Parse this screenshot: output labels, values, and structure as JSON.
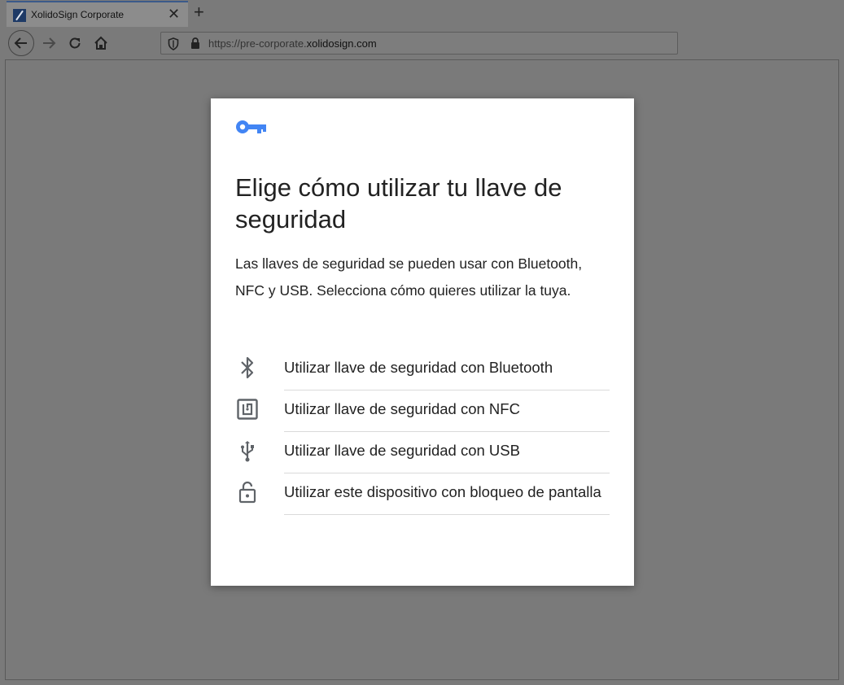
{
  "browser": {
    "tab_title": "XolidoSign Corporate",
    "url_prefix": "https://pre-corporate.",
    "url_domain": "xolidosign.com"
  },
  "dialog": {
    "title": "Elige cómo utilizar tu llave de seguridad",
    "description": "Las llaves de seguridad se pueden usar con Bluetooth, NFC y USB. Selecciona cómo quieres utilizar la tuya.",
    "accent_color": "#4285f4",
    "options": [
      {
        "label": "Utilizar llave de seguridad con Bluetooth",
        "icon": "bluetooth-icon"
      },
      {
        "label": "Utilizar llave de seguridad con NFC",
        "icon": "nfc-icon"
      },
      {
        "label": "Utilizar llave de seguridad con USB",
        "icon": "usb-icon"
      },
      {
        "label": "Utilizar este dispositivo con bloqueo de pantalla",
        "icon": "lock-icon"
      }
    ]
  }
}
